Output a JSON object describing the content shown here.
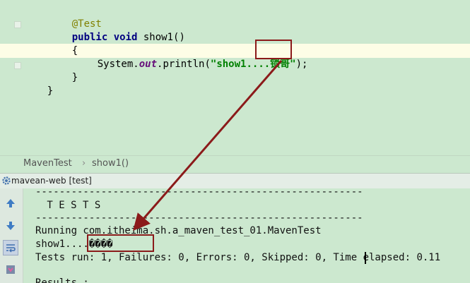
{
  "editor": {
    "annotation": "@Test",
    "kw_public": "public",
    "kw_void": "void",
    "method_sig": " show1()",
    "open_brace": "{",
    "call_prefix": "System.",
    "call_field": "out",
    "call_suffix": ".println(",
    "string_literal": "\"show1....锁哥\"",
    "call_end": ");",
    "close_brace_inner": "}",
    "close_brace_outer": "}"
  },
  "breadcrumb": {
    "class_name": "MavenTest",
    "separator": "›",
    "method_name": "show1()"
  },
  "run_panel": {
    "title": "mavean-web [test]"
  },
  "console": {
    "lines": [
      "-------------------------------------------------------",
      " T E S T S",
      "-------------------------------------------------------",
      "Running com.itheima.sh.a_maven_test_01.MavenTest",
      "show1....����",
      "Tests run: 1, Failures: 0, Errors: 0, Skipped: 0, Time elapsed: 0.11",
      "",
      "Results :"
    ]
  },
  "colors": {
    "background": "#cce8cf",
    "annotation_box": "#8b1a1a",
    "arrow": "#8b1a1a"
  }
}
